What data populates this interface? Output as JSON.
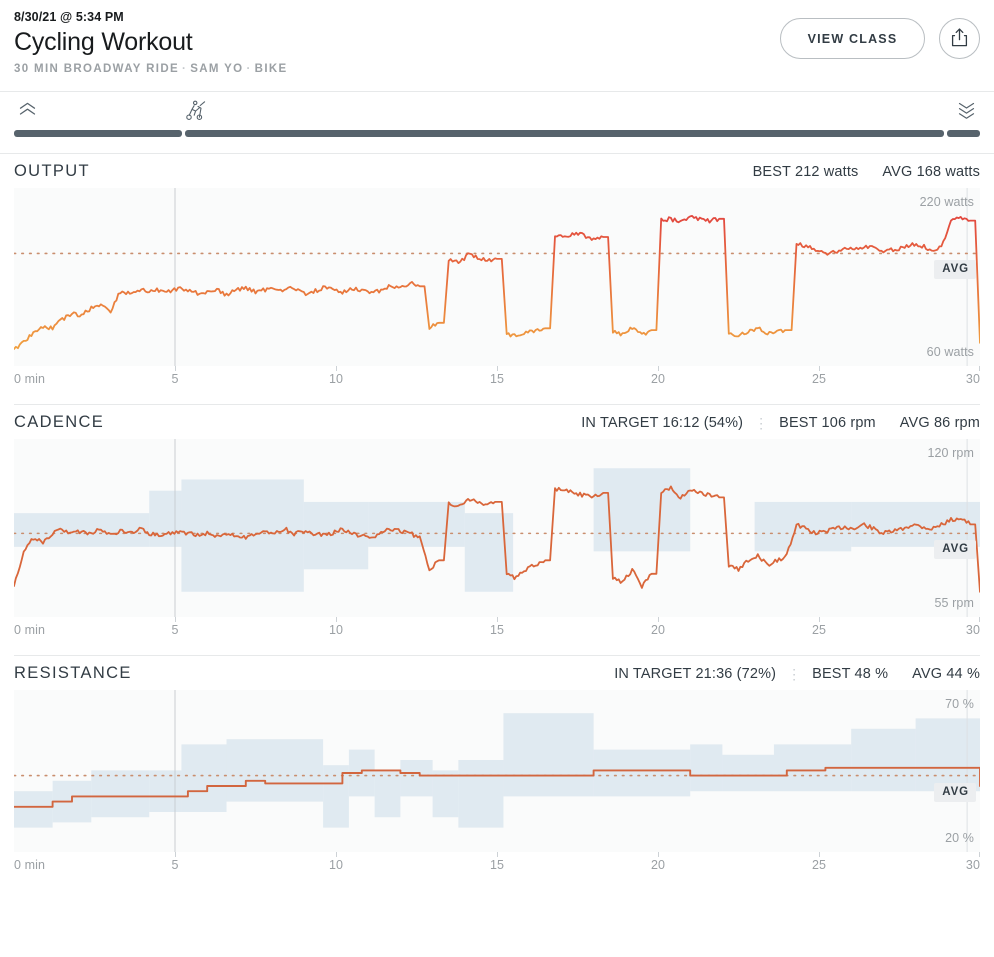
{
  "header": {
    "date": "8/30/21 @ 5:34 PM",
    "title": "Cycling Workout",
    "class_name": "30 MIN BROADWAY RIDE",
    "instructor": "SAM YO",
    "discipline": "BIKE",
    "separator": "·",
    "view_class_label": "VIEW CLASS",
    "share_icon": "share-icon"
  },
  "scrub": {
    "icon_left": "chevron-double-up-icon",
    "icon_center": "cyclist-icon",
    "icon_right": "chevron-double-down-icon",
    "segments": [
      {
        "name": "warmup"
      },
      {
        "name": "main"
      },
      {
        "name": "cooldown"
      }
    ]
  },
  "sections": [
    {
      "id": "output",
      "title": "OUTPUT",
      "in_target": null,
      "best_label": "BEST 212 watts",
      "avg_label": "AVG 168 watts",
      "avg_badge": "AVG",
      "axis_top": "220 watts",
      "axis_bottom": "60 watts"
    },
    {
      "id": "cadence",
      "title": "CADENCE",
      "in_target": "IN TARGET 16:12 (54%)",
      "separator": "⋮",
      "best_label": "BEST 106 rpm",
      "avg_label": "AVG 86 rpm",
      "avg_badge": "AVG",
      "axis_top": "120 rpm",
      "axis_bottom": "55 rpm"
    },
    {
      "id": "resistance",
      "title": "RESISTANCE",
      "in_target": "IN TARGET 21:36 (72%)",
      "separator": "⋮",
      "best_label": "BEST 48 %",
      "avg_label": "AVG 44 %",
      "avg_badge": "AVG",
      "axis_top": "70 %",
      "axis_bottom": "20 %"
    }
  ],
  "x_axis": {
    "unit_label": "0 min",
    "ticks": [
      "0 min",
      "5",
      "10",
      "15",
      "20",
      "25",
      "30"
    ],
    "tick_values": [
      0,
      5,
      10,
      15,
      20,
      25,
      30
    ]
  },
  "colors": {
    "output_low": "#f0a040",
    "output_high": "#e2483f",
    "line_cadence": "#d9663a",
    "line_resistance": "#d2663f",
    "target_zone": "#dbe6ef",
    "avg_dotted": "#c98e6e",
    "text_dark": "#323c44",
    "text_muted": "#9ba0a4",
    "chart_bg": "#fafbfb"
  },
  "chart_data": [
    {
      "type": "line",
      "title": "OUTPUT",
      "xlabel": "minutes",
      "ylabel": "watts",
      "xlim": [
        0,
        30
      ],
      "ylim": [
        60,
        220
      ],
      "grid": false,
      "avg_line": 168,
      "best": 212,
      "avg": 168,
      "x": [
        0,
        0.3,
        0.6,
        0.9,
        1.2,
        1.5,
        1.8,
        2.1,
        2.4,
        2.7,
        3.0,
        3.3,
        3.6,
        3.9,
        4.2,
        4.5,
        4.8,
        5.1,
        5.4,
        5.7,
        6.0,
        6.3,
        6.6,
        6.9,
        7.2,
        7.5,
        7.8,
        8.1,
        8.4,
        8.7,
        9.0,
        9.3,
        9.6,
        9.9,
        10.2,
        10.5,
        10.8,
        11.1,
        11.4,
        11.7,
        12.0,
        12.3,
        12.6,
        12.9,
        13.2,
        13.5,
        13.8,
        14.1,
        14.4,
        14.7,
        15.0,
        15.3,
        15.6,
        15.9,
        16.2,
        16.5,
        16.8,
        17.1,
        17.4,
        17.7,
        18.0,
        18.3,
        18.6,
        18.9,
        19.2,
        19.5,
        19.8,
        20.1,
        20.4,
        20.7,
        21.0,
        21.3,
        21.6,
        21.9,
        22.2,
        22.5,
        22.8,
        23.1,
        23.4,
        23.7,
        24.0,
        24.3,
        24.6,
        24.9,
        25.2,
        25.5,
        25.8,
        26.1,
        26.4,
        26.7,
        27.0,
        27.3,
        27.6,
        27.9,
        28.2,
        28.5,
        28.8,
        29.1,
        29.4,
        29.7,
        30.0
      ],
      "y": [
        62,
        72,
        80,
        88,
        86,
        96,
        102,
        100,
        108,
        112,
        105,
        126,
        124,
        128,
        126,
        128,
        126,
        130,
        128,
        124,
        126,
        128,
        122,
        128,
        130,
        126,
        128,
        130,
        128,
        130,
        124,
        126,
        130,
        128,
        126,
        130,
        128,
        124,
        128,
        132,
        130,
        136,
        132,
        86,
        92,
        160,
        158,
        166,
        164,
        160,
        162,
        80,
        78,
        82,
        84,
        86,
        188,
        186,
        190,
        188,
        184,
        186,
        82,
        80,
        86,
        78,
        84,
        204,
        206,
        202,
        208,
        206,
        204,
        206,
        80,
        78,
        82,
        86,
        80,
        82,
        84,
        178,
        176,
        172,
        168,
        170,
        174,
        172,
        176,
        174,
        170,
        172,
        174,
        178,
        176,
        172,
        174,
        206,
        208,
        204,
        70
      ]
    },
    {
      "type": "line",
      "title": "CADENCE",
      "xlabel": "minutes",
      "ylabel": "rpm",
      "xlim": [
        0,
        30
      ],
      "ylim": [
        55,
        120
      ],
      "grid": false,
      "avg_line": 86,
      "best": 106,
      "avg": 86,
      "in_target_time": "16:12",
      "in_target_pct": 54,
      "x": [
        0,
        0.3,
        0.6,
        0.9,
        1.2,
        1.5,
        1.8,
        2.1,
        2.4,
        2.7,
        3.0,
        3.3,
        3.6,
        3.9,
        4.2,
        4.5,
        4.8,
        5.1,
        5.4,
        5.7,
        6.0,
        6.3,
        6.6,
        6.9,
        7.2,
        7.5,
        7.8,
        8.1,
        8.4,
        8.7,
        9.0,
        9.3,
        9.6,
        9.9,
        10.2,
        10.5,
        10.8,
        11.1,
        11.4,
        11.7,
        12.0,
        12.3,
        12.6,
        12.9,
        13.2,
        13.5,
        13.8,
        14.1,
        14.4,
        14.7,
        15.0,
        15.3,
        15.6,
        15.9,
        16.2,
        16.5,
        16.8,
        17.1,
        17.4,
        17.7,
        18.0,
        18.3,
        18.6,
        18.9,
        19.2,
        19.5,
        19.8,
        20.1,
        20.4,
        20.7,
        21.0,
        21.3,
        21.6,
        21.9,
        22.2,
        22.5,
        22.8,
        23.1,
        23.4,
        23.7,
        24.0,
        24.3,
        24.6,
        24.9,
        25.2,
        25.5,
        25.8,
        26.1,
        26.4,
        26.7,
        27.0,
        27.3,
        27.6,
        27.9,
        28.2,
        28.5,
        28.8,
        29.1,
        29.4,
        29.7,
        30.0
      ],
      "y": [
        62,
        78,
        84,
        82,
        86,
        88,
        86,
        87,
        86,
        88,
        85,
        87,
        86,
        88,
        86,
        85,
        86,
        87,
        86,
        85,
        86,
        85,
        86,
        85,
        84,
        86,
        87,
        86,
        88,
        86,
        87,
        86,
        85,
        86,
        88,
        86,
        85,
        84,
        86,
        88,
        87,
        86,
        84,
        70,
        74,
        100,
        98,
        101,
        100,
        99,
        100,
        68,
        66,
        70,
        72,
        74,
        106,
        105,
        104,
        103,
        102,
        104,
        66,
        64,
        70,
        62,
        68,
        104,
        106,
        102,
        105,
        104,
        103,
        102,
        72,
        70,
        74,
        76,
        72,
        74,
        76,
        90,
        88,
        86,
        87,
        88,
        89,
        88,
        90,
        88,
        86,
        87,
        88,
        90,
        89,
        88,
        90,
        92,
        93,
        90,
        60
      ],
      "target_zones": [
        {
          "start": 0,
          "end": 4.2,
          "low": 80,
          "high": 95
        },
        {
          "start": 4.2,
          "end": 5.2,
          "low": 80,
          "high": 105
        },
        {
          "start": 5.2,
          "end": 9.0,
          "low": 60,
          "high": 110
        },
        {
          "start": 9.0,
          "end": 11.0,
          "low": 70,
          "high": 100
        },
        {
          "start": 11.0,
          "end": 14.0,
          "low": 80,
          "high": 100
        },
        {
          "start": 14.0,
          "end": 15.5,
          "low": 60,
          "high": 95
        },
        {
          "start": 18.0,
          "end": 21.0,
          "low": 78,
          "high": 115
        },
        {
          "start": 23.0,
          "end": 26.0,
          "low": 78,
          "high": 100
        },
        {
          "start": 26.0,
          "end": 30.0,
          "low": 80,
          "high": 100
        }
      ]
    },
    {
      "type": "line",
      "title": "RESISTANCE",
      "xlabel": "minutes",
      "ylabel": "%",
      "xlim": [
        20,
        70
      ],
      "ylim": [
        20,
        70
      ],
      "grid": false,
      "avg_line": 44,
      "best": 48,
      "avg": 44,
      "in_target_time": "21:36",
      "in_target_pct": 72,
      "x": [
        0,
        0.6,
        1.2,
        1.8,
        2.4,
        3.0,
        3.6,
        4.2,
        4.8,
        5.4,
        6.0,
        6.6,
        7.2,
        7.8,
        8.4,
        9.0,
        9.6,
        10.2,
        10.8,
        11.4,
        12.0,
        12.6,
        13.2,
        13.8,
        14.4,
        15.0,
        15.6,
        16.2,
        16.8,
        17.4,
        18.0,
        18.6,
        19.2,
        19.8,
        20.4,
        21.0,
        21.6,
        22.2,
        22.8,
        23.4,
        24.0,
        24.6,
        25.2,
        25.8,
        26.4,
        27.0,
        27.6,
        28.2,
        28.8,
        29.4,
        30.0
      ],
      "y": [
        32,
        32,
        34,
        36,
        36,
        36,
        36,
        36,
        36,
        38,
        40,
        40,
        42,
        41,
        41,
        41,
        41,
        45,
        46,
        46,
        45,
        44,
        44,
        44,
        44,
        44,
        44,
        44,
        44,
        44,
        46,
        46,
        46,
        46,
        46,
        44,
        44,
        44,
        44,
        44,
        46,
        46,
        47,
        47,
        47,
        47,
        47,
        47,
        47,
        47,
        40
      ],
      "target_zones": [
        {
          "start": 0,
          "end": 1.2,
          "low": 24,
          "high": 38
        },
        {
          "start": 1.2,
          "end": 2.4,
          "low": 26,
          "high": 42
        },
        {
          "start": 2.4,
          "end": 4.2,
          "low": 28,
          "high": 46
        },
        {
          "start": 4.2,
          "end": 5.2,
          "low": 30,
          "high": 46
        },
        {
          "start": 5.2,
          "end": 6.6,
          "low": 30,
          "high": 56
        },
        {
          "start": 6.6,
          "end": 9.6,
          "low": 34,
          "high": 58
        },
        {
          "start": 9.6,
          "end": 10.4,
          "low": 24,
          "high": 48
        },
        {
          "start": 10.4,
          "end": 11.2,
          "low": 36,
          "high": 54
        },
        {
          "start": 11.2,
          "end": 12.0,
          "low": 28,
          "high": 46
        },
        {
          "start": 12.0,
          "end": 13.0,
          "low": 36,
          "high": 50
        },
        {
          "start": 13.0,
          "end": 13.8,
          "low": 28,
          "high": 46
        },
        {
          "start": 13.8,
          "end": 15.2,
          "low": 24,
          "high": 50
        },
        {
          "start": 15.2,
          "end": 18.0,
          "low": 36,
          "high": 68
        },
        {
          "start": 18.0,
          "end": 21.0,
          "low": 36,
          "high": 54
        },
        {
          "start": 21.0,
          "end": 22.0,
          "low": 38,
          "high": 56
        },
        {
          "start": 22.0,
          "end": 23.6,
          "low": 38,
          "high": 52
        },
        {
          "start": 23.6,
          "end": 26.0,
          "low": 38,
          "high": 56
        },
        {
          "start": 26.0,
          "end": 28.0,
          "low": 38,
          "high": 62
        },
        {
          "start": 28.0,
          "end": 30.0,
          "low": 38,
          "high": 66
        }
      ]
    }
  ]
}
